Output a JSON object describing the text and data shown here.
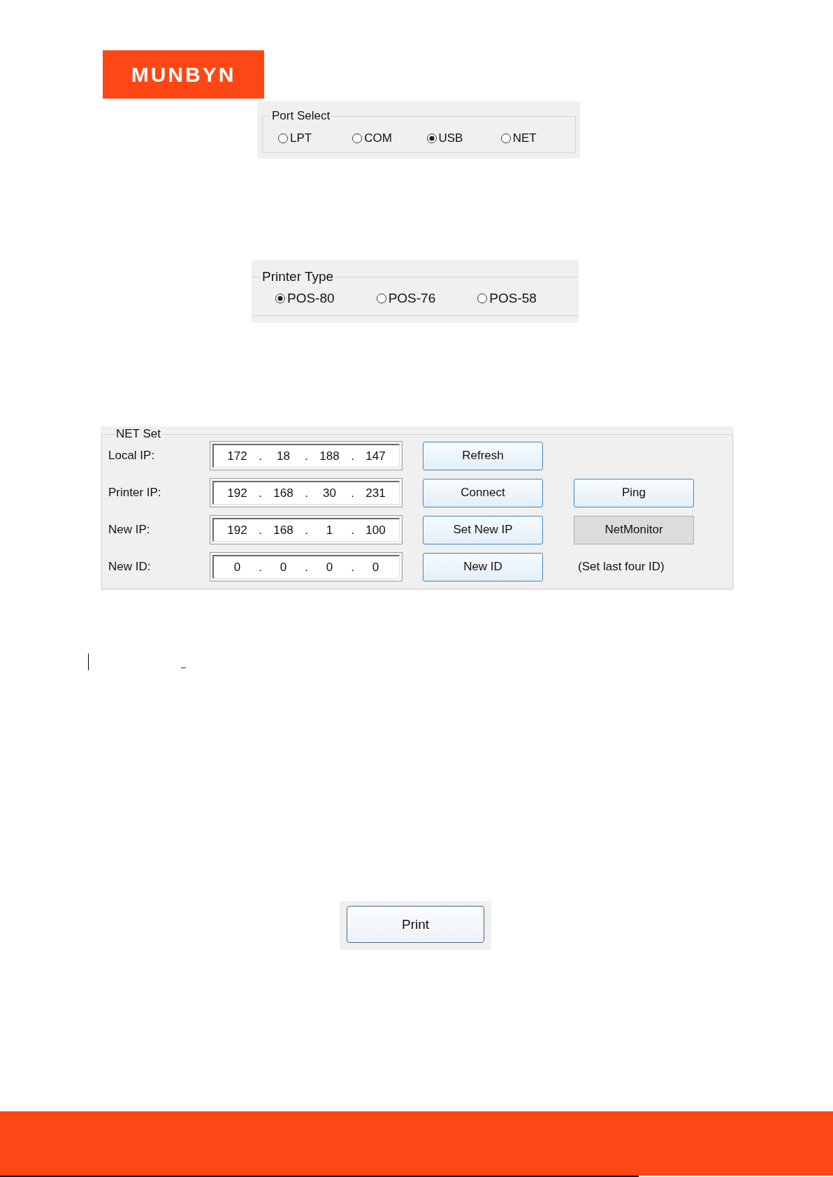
{
  "logo": {
    "text": "MUNBYN"
  },
  "port_select": {
    "title": "Port Select",
    "options": [
      {
        "label": "LPT",
        "selected": false
      },
      {
        "label": "COM",
        "selected": false
      },
      {
        "label": "USB",
        "selected": true
      },
      {
        "label": "NET",
        "selected": false
      }
    ]
  },
  "printer_type": {
    "title": "Printer Type",
    "options": [
      {
        "label": "POS-80",
        "selected": true
      },
      {
        "label": "POS-76",
        "selected": false
      },
      {
        "label": "POS-58",
        "selected": false
      }
    ]
  },
  "net_set": {
    "title": "NET Set",
    "rows": [
      {
        "label": "Local IP:",
        "address": [
          "172",
          ".",
          "18",
          ".",
          "188",
          ".",
          "147"
        ],
        "button": "Refresh"
      },
      {
        "label": "Printer IP:",
        "address": [
          "192",
          ".",
          "168",
          ".",
          "30",
          ".",
          "231"
        ],
        "button": "Connect",
        "side": {
          "kind": "button",
          "text": "Ping"
        }
      },
      {
        "label": "New IP:",
        "address": [
          "192",
          ".",
          "168",
          ".",
          "1",
          ".",
          "100"
        ],
        "button": "Set New IP",
        "side": {
          "kind": "flat_button",
          "text": "NetMonitor"
        }
      },
      {
        "label": "New ID:",
        "address": [
          "0",
          ".",
          "0",
          ".",
          "0",
          ".",
          "0"
        ],
        "button": "New ID",
        "side": {
          "kind": "note",
          "text": "(Set last four ID)"
        }
      }
    ]
  },
  "print_button": {
    "label": "Print"
  }
}
